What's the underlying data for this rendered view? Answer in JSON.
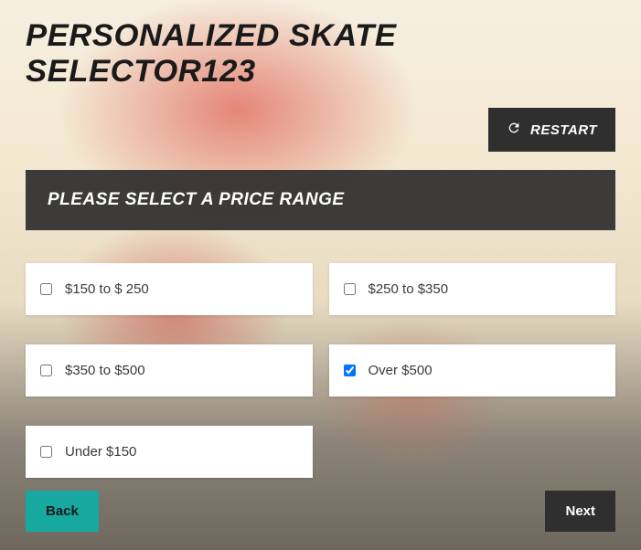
{
  "header": {
    "title": "PERSONALIZED SKATE SELECTOR123",
    "restart_label": "RESTART"
  },
  "instruction": "PLEASE SELECT A PRICE RANGE",
  "options": [
    {
      "label": "$150 to $ 250",
      "checked": false
    },
    {
      "label": "$250 to $350",
      "checked": false
    },
    {
      "label": "$350 to $500",
      "checked": false
    },
    {
      "label": "Over $500",
      "checked": true
    },
    {
      "label": "Under $150",
      "checked": false
    }
  ],
  "nav": {
    "back_label": "Back",
    "next_label": "Next"
  },
  "icons": {
    "restart": "refresh-icon"
  },
  "colors": {
    "accent": "#17a8a0",
    "dark": "#2f2f2f"
  }
}
